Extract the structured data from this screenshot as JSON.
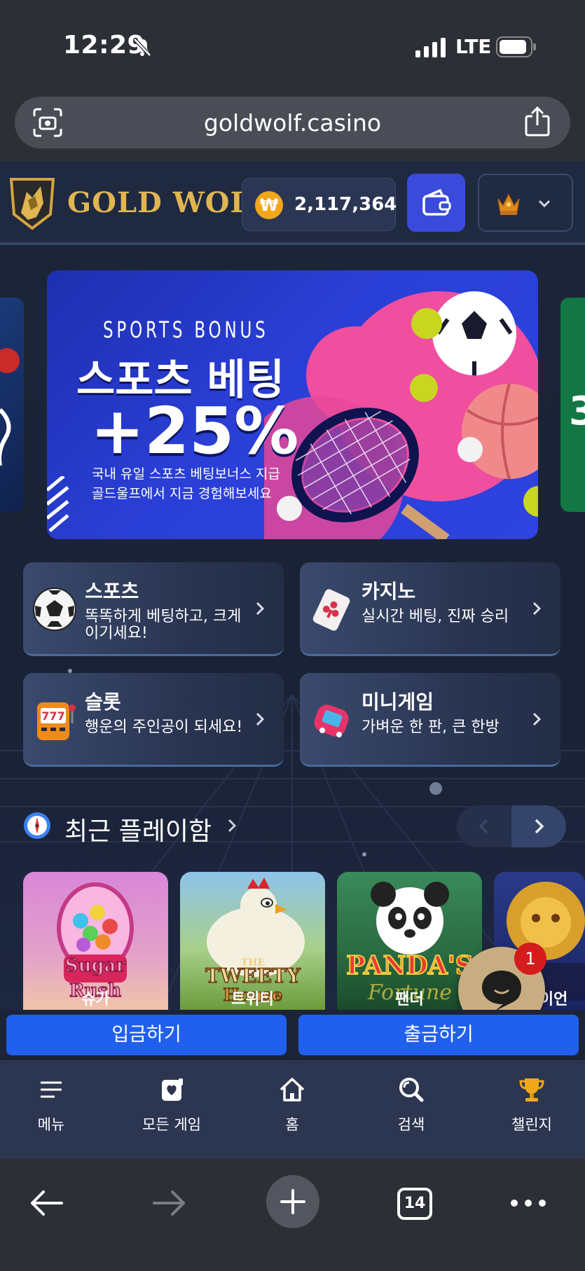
{
  "status_bar": {
    "time": "12:29",
    "network": "LTE"
  },
  "browser": {
    "url": "goldwolf.casino",
    "tab_count": "14"
  },
  "header": {
    "brand": "GOLD WOLF",
    "currency_symbol": "₩",
    "balance": "2,117,364"
  },
  "banner": {
    "eyebrow": "SPORTS BONUS",
    "title": "스포츠 베팅",
    "percent": "+25%",
    "subtitle_line1": "국내 유일 스포츠 베팅보너스 지급",
    "subtitle_line2": "골드울프에서 지금 경험해보세요",
    "next_banner_peek": "3"
  },
  "categories": [
    {
      "title": "스포츠",
      "desc": "똑똑하게 베팅하고, 크게 이기세요!",
      "icon": "soccer-ball-icon"
    },
    {
      "title": "카지노",
      "desc": "실시간 베팅, 진짜 승리",
      "icon": "card-icon"
    },
    {
      "title": "슬롯",
      "desc": "행운의 주인공이 되세요!",
      "icon": "slot-machine-icon"
    },
    {
      "title": "미니게임",
      "desc": "가벼운 한 판, 큰 한방",
      "icon": "mini-game-icon"
    }
  ],
  "recent": {
    "title": "최근 플레이함",
    "games": [
      {
        "label": "슈가",
        "art": "Sugar Rush"
      },
      {
        "label": "트위티",
        "art": "The Tweety House"
      },
      {
        "label": "팬더",
        "art": "Panda's Fortune"
      },
      {
        "label": "라이언",
        "art": ""
      }
    ]
  },
  "chat": {
    "badge": "1"
  },
  "actions": {
    "deposit": "입금하기",
    "withdraw": "출금하기"
  },
  "bottom_nav": [
    {
      "label": "메뉴",
      "icon": "menu-icon"
    },
    {
      "label": "모든 게임",
      "icon": "games-icon"
    },
    {
      "label": "홈",
      "icon": "home-icon"
    },
    {
      "label": "검색",
      "icon": "search-icon"
    },
    {
      "label": "챌린지",
      "icon": "trophy-icon"
    }
  ],
  "colors": {
    "accent_blue": "#2160ee",
    "gold": "#e0b552",
    "wallet_blue": "#3a4bdc",
    "page_bg": "#1b2232"
  }
}
